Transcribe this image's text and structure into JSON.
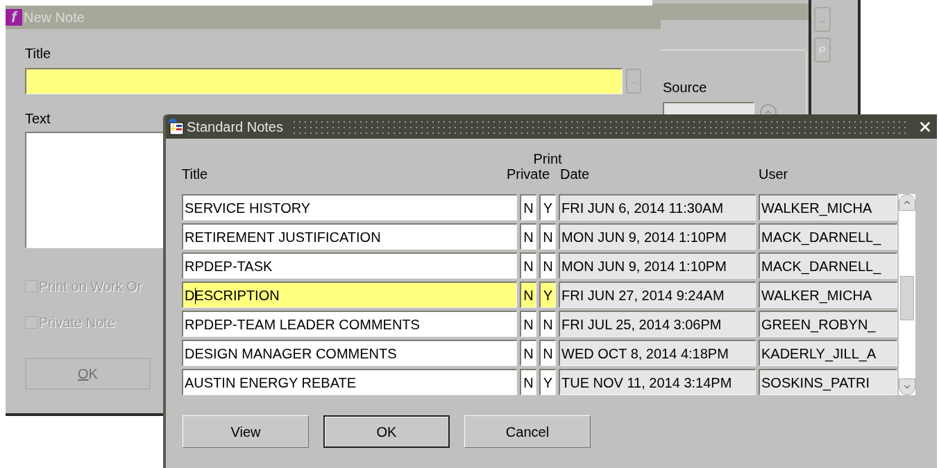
{
  "background_window": {
    "source_label": "Source",
    "lookup_button": "..."
  },
  "new_note": {
    "logo_letter": "f",
    "title": "New Note",
    "title_label": "Title",
    "lookup_button": "...",
    "text_label": "Text",
    "checkboxes": [
      {
        "label": "Print on Work Or",
        "checked": false,
        "disabled": true
      },
      {
        "label": "Private Note",
        "checked": false,
        "disabled": true
      }
    ],
    "ok_button": {
      "label": "OK",
      "disabled": true
    }
  },
  "standard_notes": {
    "title": "Standard Notes",
    "columns": {
      "title": "Title",
      "private": "Private",
      "print": "Print",
      "date": "Date",
      "user": "User"
    },
    "rows": [
      {
        "title": "SERVICE HISTORY",
        "private": "N",
        "print": "Y",
        "date": "FRI JUN 6, 2014 11:30AM",
        "user": "WALKER_MICHA",
        "selected": false
      },
      {
        "title": "RETIREMENT JUSTIFICATION",
        "private": "N",
        "print": "N",
        "date": "MON JUN 9, 2014 1:10PM",
        "user": "MACK_DARNELL_",
        "selected": false
      },
      {
        "title": "RPDEP-TASK",
        "private": "N",
        "print": "N",
        "date": "MON JUN 9, 2014 1:10PM",
        "user": "MACK_DARNELL_",
        "selected": false
      },
      {
        "title": "DESCRIPTION",
        "private": "N",
        "print": "Y",
        "date": "FRI JUN 27, 2014 9:24AM",
        "user": "WALKER_MICHA",
        "selected": true
      },
      {
        "title": "RPDEP-TEAM LEADER COMMENTS",
        "private": "N",
        "print": "N",
        "date": "FRI JUL 25, 2014 3:06PM",
        "user": "GREEN_ROBYN_",
        "selected": false
      },
      {
        "title": "DESIGN MANAGER COMMENTS",
        "private": "N",
        "print": "N",
        "date": "WED OCT 8, 2014 4:18PM",
        "user": "KADERLY_JILL_A",
        "selected": false
      },
      {
        "title": "AUSTIN ENERGY REBATE",
        "private": "N",
        "print": "Y",
        "date": "TUE NOV 11, 2014 3:14PM",
        "user": "SOSKINS_PATRI",
        "selected": false
      }
    ],
    "buttons": [
      {
        "label": "View",
        "default": false
      },
      {
        "label": "OK",
        "default": true
      },
      {
        "label": "Cancel",
        "default": false
      }
    ]
  }
}
